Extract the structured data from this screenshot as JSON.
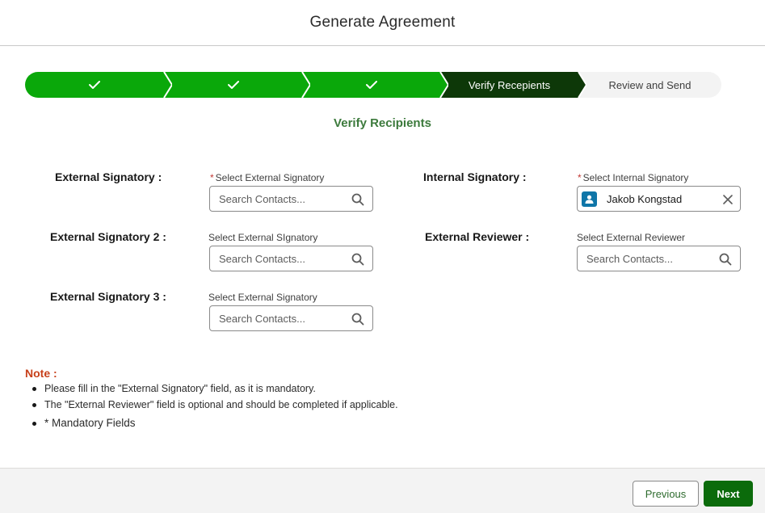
{
  "header": {
    "title": "Generate Agreement"
  },
  "path": {
    "steps": [
      {
        "label": "",
        "state": "complete"
      },
      {
        "label": "",
        "state": "complete"
      },
      {
        "label": "",
        "state": "complete"
      },
      {
        "label": "Verify Recepients",
        "state": "current"
      },
      {
        "label": "Review and Send",
        "state": "incomplete"
      }
    ]
  },
  "section": {
    "title": "Verify Recipients"
  },
  "form": {
    "external_signatory": {
      "label": "External Signatory :",
      "caption": "Select External Signatory",
      "required": true,
      "placeholder": "Search Contacts...",
      "value": ""
    },
    "external_signatory_2": {
      "label": "External Signatory 2 :",
      "caption": "Select External SIgnatory",
      "required": false,
      "placeholder": "Search Contacts...",
      "value": ""
    },
    "external_signatory_3": {
      "label": "External Signatory 3 :",
      "caption": "Select External Signatory",
      "required": false,
      "placeholder": "Search Contacts...",
      "value": ""
    },
    "internal_signatory": {
      "label": "Internal Signatory :",
      "caption": "Select Internal Signatory",
      "required": true,
      "selected_name": "Jakob Kongstad"
    },
    "external_reviewer": {
      "label": "External Reviewer :",
      "caption": "Select External Reviewer",
      "required": false,
      "placeholder": "Search Contacts...",
      "value": ""
    },
    "required_marker": "*"
  },
  "note": {
    "title": "Note :",
    "items": [
      "Please fill in the \"External Signatory\" field, as it is mandatory.",
      "The \"External Reviewer\" field is optional and should be completed if applicable.",
      "* Mandatory Fields"
    ]
  },
  "footer": {
    "previous_label": "Previous",
    "next_label": "Next"
  },
  "colors": {
    "step_complete": "#0aa80a",
    "step_current": "#0d3808",
    "step_incomplete": "#f3f3f3",
    "section_title": "#3c7a3c",
    "note_title": "#c7401a",
    "next_button": "#0b6b0b",
    "avatar": "#0f76a8"
  },
  "icons": {
    "step_complete": "checkmark-icon",
    "input_search": "search-icon",
    "avatar": "contact-avatar-icon",
    "clear": "close-icon"
  }
}
